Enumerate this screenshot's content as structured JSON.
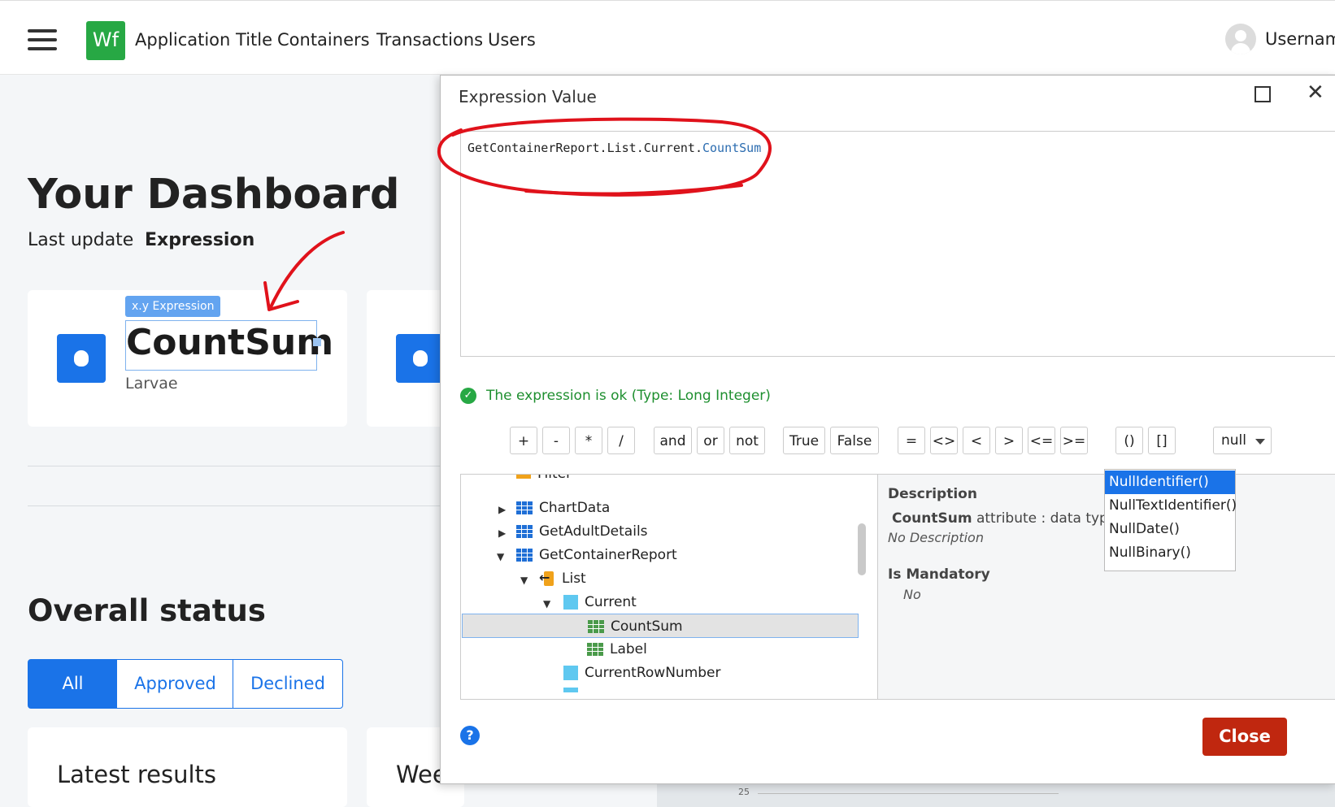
{
  "header": {
    "logo_text": "Wf",
    "app_title": "Application Title",
    "nav": [
      "Containers",
      "Transactions",
      "Users"
    ],
    "username": "Username"
  },
  "dashboard": {
    "title": "Your Dashboard",
    "last_update_label": "Last update",
    "last_update_value": "Expression",
    "widget_badge": "x.y Expression",
    "card_value": "CountSum",
    "card_label": "Larvae",
    "overall_status": "Overall status",
    "filters": [
      "All",
      "Approved",
      "Declined"
    ],
    "active_filter": "All",
    "latest_results": "Latest results",
    "weekly_partial": "Wee",
    "chart_tick": "25"
  },
  "dialog": {
    "title": "Expression Value",
    "expression_prefix": "GetContainerReport.List.Current.",
    "expression_attr": "CountSum",
    "status": "The expression is ok (Type: Long Integer)",
    "operators": [
      "+",
      "-",
      "*",
      "/",
      "and",
      "or",
      "not",
      "True",
      "False",
      "=",
      "<>",
      "<",
      ">",
      "<=",
      ">=",
      "()",
      "[]"
    ],
    "null_select": "null",
    "null_options": [
      "NullIdentifier()",
      "NullTextIdentifier()",
      "NullDate()",
      "NullBinary()"
    ],
    "null_highlighted": "NullIdentifier()",
    "tree": {
      "partial_top": "Filter",
      "items": [
        "ChartData",
        "GetAdultDetails",
        "GetContainerReport",
        "List",
        "Current",
        "CountSum",
        "Label",
        "CurrentRowNumber"
      ],
      "selected": "CountSum"
    },
    "description": {
      "heading": "Description",
      "attr_name": "CountSum",
      "attr_text": "attribute : data type I",
      "no_description": "No Description",
      "mandatory_heading": "Is Mandatory",
      "mandatory_value": "No"
    },
    "help_glyph": "?",
    "close_label": "Close"
  },
  "colors": {
    "primary": "#1a73e8",
    "logo_green": "#27a844",
    "close_red": "#c0270f",
    "annotation_red": "#e0121b"
  }
}
